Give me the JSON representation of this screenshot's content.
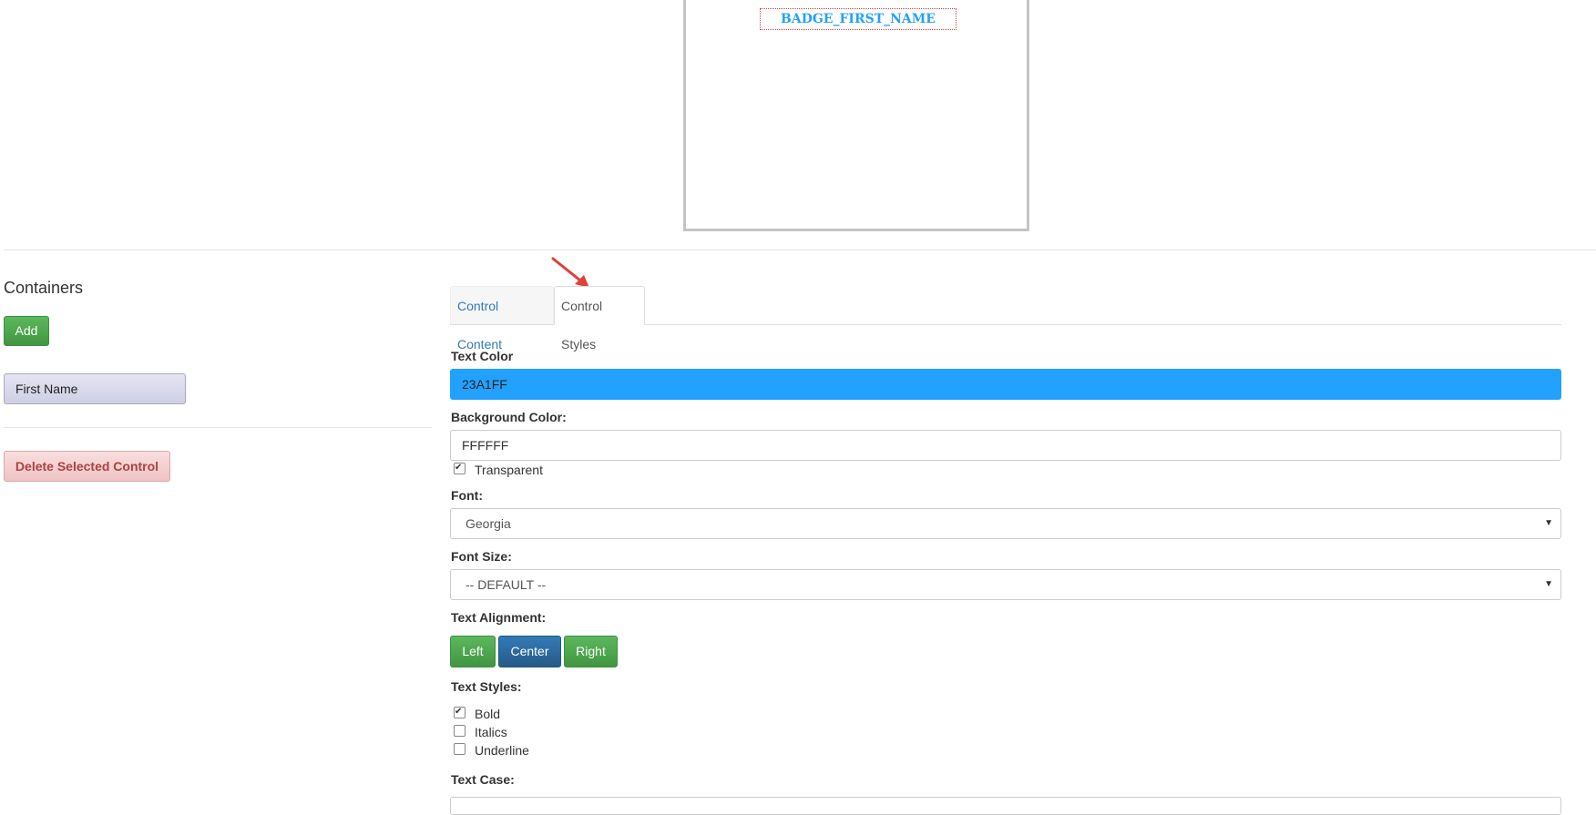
{
  "badge": {
    "field_text": "BADGE_FIRST_NAME",
    "field_color": "#23a1ff"
  },
  "containers": {
    "title": "Containers",
    "add_label": "Add",
    "items": [
      {
        "label": "First Name"
      }
    ],
    "delete_label": "Delete Selected Control"
  },
  "tabs": [
    {
      "label": "Control Content",
      "active": false
    },
    {
      "label": "Control Styles",
      "active": true
    }
  ],
  "form": {
    "text_color": {
      "label": "Text Color",
      "value": "23A1FF"
    },
    "background_color": {
      "label": "Background Color:",
      "value": "FFFFFF"
    },
    "transparent": {
      "label": "Transparent",
      "checked": true
    },
    "font": {
      "label": "Font:",
      "value": "Georgia"
    },
    "font_size": {
      "label": "Font Size:",
      "value": "-- DEFAULT --"
    },
    "text_alignment": {
      "label": "Text Alignment:",
      "options": [
        "Left",
        "Center",
        "Right"
      ],
      "selected": "Center"
    },
    "text_styles": {
      "label": "Text Styles:",
      "options": [
        {
          "label": "Bold",
          "checked": true
        },
        {
          "label": "Italics",
          "checked": false
        },
        {
          "label": "Underline",
          "checked": false
        }
      ]
    },
    "text_case": {
      "label": "Text Case:"
    }
  },
  "colors": {
    "accent": "#23a1ff",
    "success": "#5cb85c",
    "primary": "#337ab7",
    "danger_text": "#a94442"
  },
  "icons": {
    "annotation_arrow": "red-arrow-icon",
    "select_caret": "caret-down-icon"
  }
}
